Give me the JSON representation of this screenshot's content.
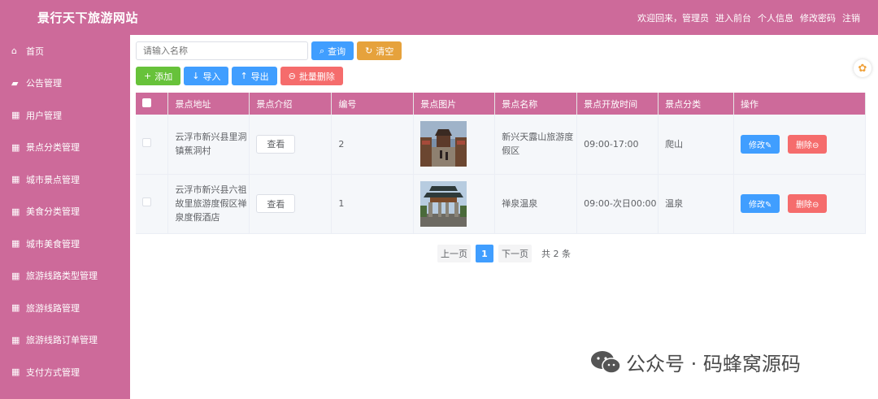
{
  "header": {
    "title": "景行天下旅游网站",
    "welcome": "欢迎回来，管理员",
    "links": [
      "进入前台",
      "个人信息",
      "修改密码",
      "注销"
    ]
  },
  "sidebar": {
    "items": [
      {
        "label": "首页",
        "icon": "home-icon"
      },
      {
        "label": "公告管理",
        "icon": "chat-icon"
      },
      {
        "label": "用户管理",
        "icon": "grid-icon"
      },
      {
        "label": "景点分类管理",
        "icon": "grid-icon"
      },
      {
        "label": "城市景点管理",
        "icon": "grid-icon"
      },
      {
        "label": "美食分类管理",
        "icon": "grid-icon"
      },
      {
        "label": "城市美食管理",
        "icon": "grid-icon"
      },
      {
        "label": "旅游线路类型管理",
        "icon": "grid-icon"
      },
      {
        "label": "旅游线路管理",
        "icon": "grid-icon"
      },
      {
        "label": "旅游线路订单管理",
        "icon": "grid-icon"
      },
      {
        "label": "支付方式管理",
        "icon": "grid-icon"
      }
    ]
  },
  "search": {
    "placeholder": "请输入名称",
    "query_label": "查询",
    "clear_label": "清空"
  },
  "actions": {
    "add": "添加",
    "import": "导入",
    "export": "导出",
    "batch_delete": "批量删除"
  },
  "table": {
    "columns": [
      "景点地址",
      "景点介绍",
      "编号",
      "景点图片",
      "景点名称",
      "景点开放时间",
      "景点分类",
      "操作"
    ],
    "rows": [
      {
        "address": "云浮市新兴县里洞镇蕉洞村",
        "intro": "查看",
        "id": "2",
        "name": "新兴天露山旅游度假区",
        "hours": "09:00-17:00",
        "category": "爬山",
        "edit": "修改",
        "delete": "删除"
      },
      {
        "address": "云浮市新兴县六祖故里旅游度假区禅泉度假酒店",
        "intro": "查看",
        "id": "1",
        "name": "禅泉温泉",
        "hours": "09:00-次日00:00",
        "category": "温泉",
        "edit": "修改",
        "delete": "删除"
      }
    ]
  },
  "pager": {
    "prev": "上一页",
    "current": "1",
    "next": "下一页",
    "total": "共 2 条"
  },
  "watermark": "公众号 · 码蜂窝源码",
  "colors": {
    "theme": "#cd6a9a",
    "primary": "#409eff",
    "success": "#67c23a",
    "warning": "#e6a23c",
    "danger": "#f56c6c"
  }
}
